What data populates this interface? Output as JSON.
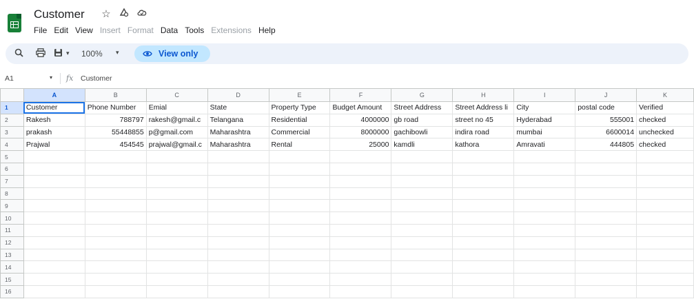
{
  "app": {
    "title": "Customer",
    "icons": [
      "star-icon",
      "move-to-drive-icon",
      "cloud-status-icon"
    ]
  },
  "menu": {
    "items": [
      {
        "label": "File",
        "enabled": true
      },
      {
        "label": "Edit",
        "enabled": true
      },
      {
        "label": "View",
        "enabled": true
      },
      {
        "label": "Insert",
        "enabled": false
      },
      {
        "label": "Format",
        "enabled": false
      },
      {
        "label": "Data",
        "enabled": true
      },
      {
        "label": "Tools",
        "enabled": true
      },
      {
        "label": "Extensions",
        "enabled": false
      },
      {
        "label": "Help",
        "enabled": true
      }
    ]
  },
  "toolbar": {
    "zoom": "100%",
    "view_only_label": "View only"
  },
  "formula_bar": {
    "cell_ref": "A1",
    "fx": "fx",
    "value": "Customer"
  },
  "sheet": {
    "columns": [
      "A",
      "B",
      "C",
      "D",
      "E",
      "F",
      "G",
      "H",
      "I",
      "J",
      "K"
    ],
    "row_numbers": [
      "1",
      "2",
      "3",
      "4",
      "5",
      "6",
      "7",
      "8",
      "9",
      "10",
      "11",
      "12",
      "13",
      "14",
      "15",
      "16"
    ],
    "rows": [
      [
        "Customer",
        "Phone Number",
        "Emial",
        "State",
        "Property Type",
        "Budget Amount",
        "Street Address",
        "Street Address li",
        "City",
        "postal code",
        "Verified"
      ],
      [
        "Rakesh",
        "788797",
        "rakesh@gmail.c",
        "Telangana",
        "Residential",
        "4000000",
        "gb road",
        "street no 45",
        "Hyderabad",
        "555001",
        "checked"
      ],
      [
        "prakash",
        "55448855",
        "p@gmail.com",
        "Maharashtra",
        "Commercial",
        "8000000",
        "gachibowli",
        "indira road",
        "mumbai",
        "6600014",
        "unchecked"
      ],
      [
        "Prajwal",
        "454545",
        "prajwal@gmail.c",
        "Maharashtra",
        "Rental",
        "25000",
        "kamdli",
        "kathora",
        "Amravati",
        "444805",
        "checked"
      ]
    ],
    "numeric_columns": [
      1,
      5,
      9
    ]
  },
  "colors": {
    "accent": "#0b57d0",
    "view_only_bg": "#c2e7ff",
    "sheets_green": "#188038"
  }
}
